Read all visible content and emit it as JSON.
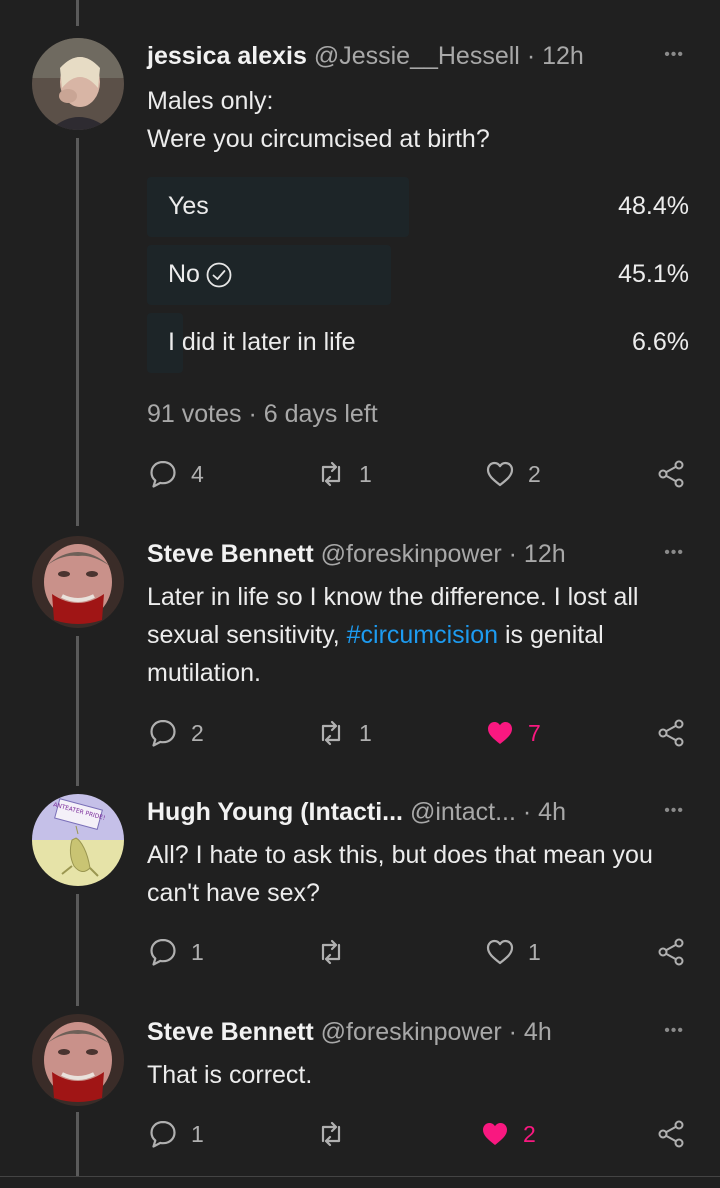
{
  "tweets": [
    {
      "name": "jessica alexis",
      "handle": "@Jessie__Hessell",
      "time": "· 12h",
      "text_lines": [
        "Males only:",
        "Were you circumcised at birth?"
      ],
      "poll": {
        "options": [
          {
            "label": "Yes",
            "percent": "48.4%",
            "fraction": 0.484,
            "selected": false
          },
          {
            "label": "No",
            "percent": "45.1%",
            "fraction": 0.451,
            "selected": true
          },
          {
            "label": "I did it later in life",
            "percent": "6.6%",
            "fraction": 0.066,
            "selected": false
          }
        ],
        "summary": "91 votes · 6 days left"
      },
      "replies": "4",
      "retweets": "1",
      "likes": "2",
      "liked": false
    },
    {
      "name": "Steve Bennett",
      "handle": "@foreskinpower",
      "time": "· 12h",
      "text_before": "Later in life so I know the difference. I lost all sexual sensitivity, ",
      "hashtag": "#circumcision",
      "text_after": " is genital mutilation.",
      "replies": "2",
      "retweets": "1",
      "likes": "7",
      "liked": true
    },
    {
      "name": "Hugh Young (Intacti...",
      "handle": "@intact...",
      "time": "· 4h",
      "text": "All? I hate to ask this, but does that mean you can't have sex?",
      "avatar_text": "ANTEATER PRIDE!",
      "replies": "1",
      "retweets": "",
      "likes": "1",
      "liked": false
    },
    {
      "name": "Steve Bennett",
      "handle": "@foreskinpower",
      "time": "· 4h",
      "text": "That is correct.",
      "replies": "1",
      "retweets": "",
      "likes": "2",
      "liked": true
    }
  ],
  "colors": {
    "background": "#202020",
    "link": "#1d9bf0",
    "like": "#f91880",
    "poll_fill": "#1d2528"
  }
}
